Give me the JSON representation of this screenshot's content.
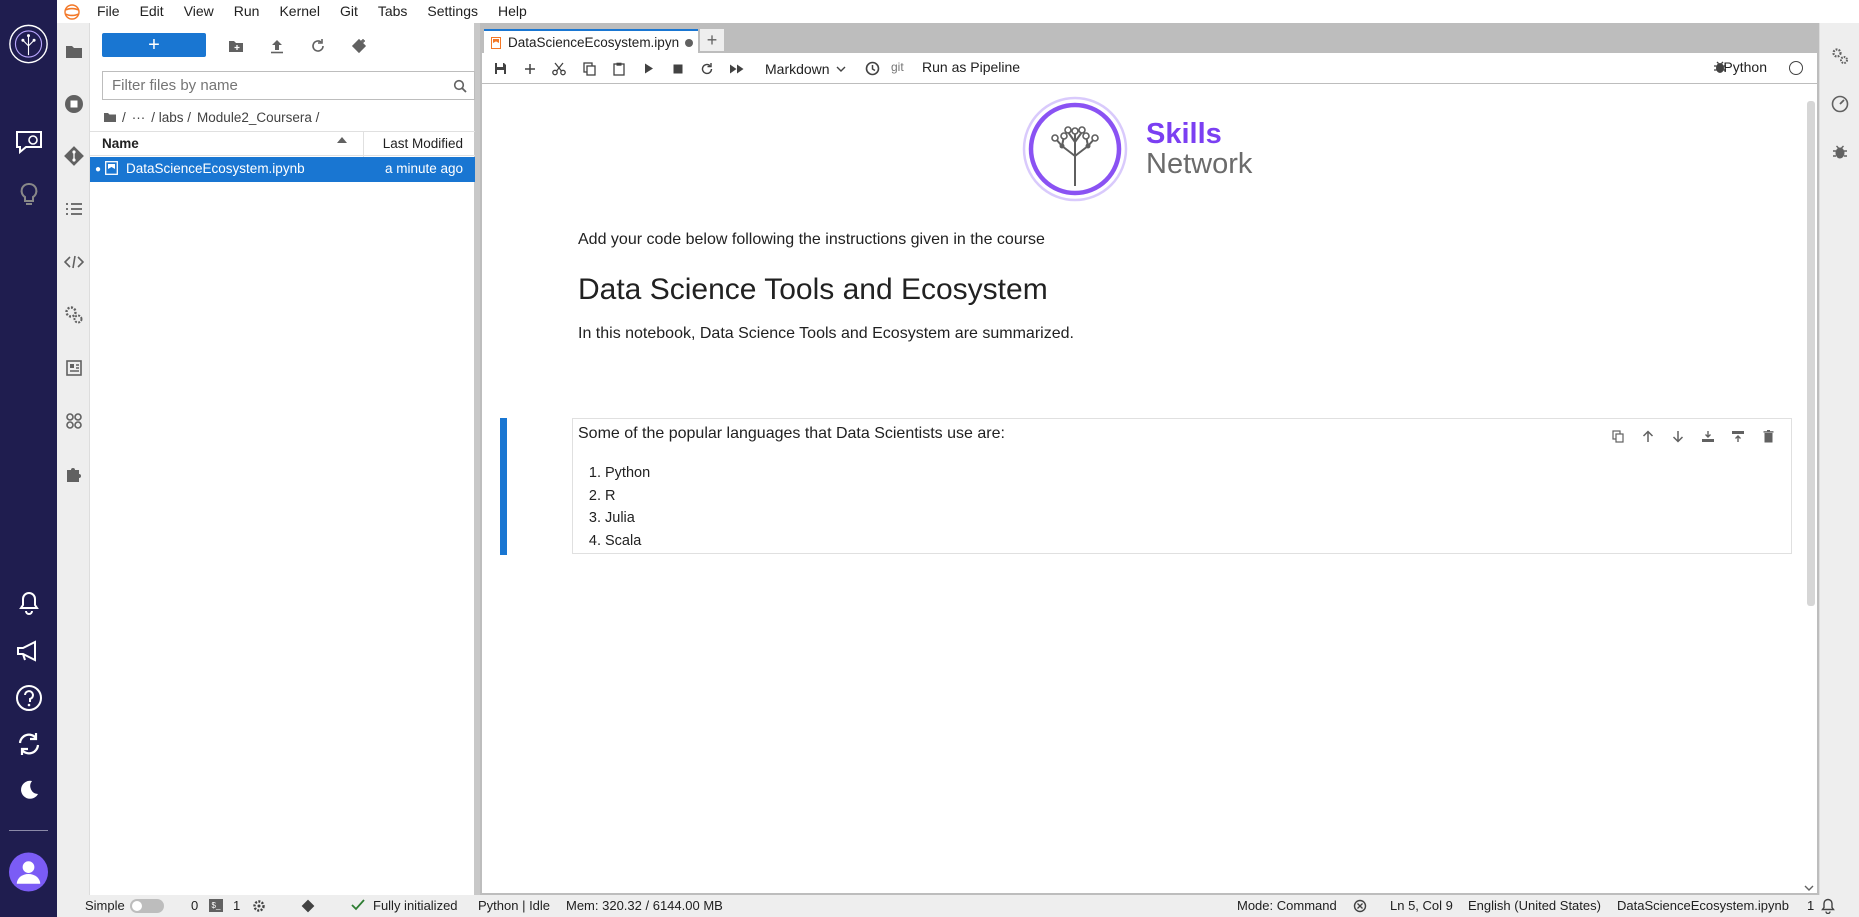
{
  "menu": {
    "items": [
      "File",
      "Edit",
      "View",
      "Run",
      "Kernel",
      "Git",
      "Tabs",
      "Settings",
      "Help"
    ]
  },
  "filebrowser": {
    "new_label": "+",
    "search_placeholder": "Filter files by name",
    "breadcrumb": [
      "/",
      "···",
      "/ labs /",
      "Module2_Coursera /"
    ],
    "columns": {
      "name": "Name",
      "modified": "Last Modified"
    },
    "files": [
      {
        "name": "DataScienceEcosystem.ipynb",
        "modified": "a minute ago",
        "selected": true
      }
    ]
  },
  "tabs": {
    "active": "DataScienceEcosystem.ipyn",
    "add": "+"
  },
  "notebook_toolbar": {
    "cell_type": "Markdown",
    "git": "git",
    "pipeline": "Run as Pipeline",
    "kernel": "Python"
  },
  "notebook": {
    "logo_line1": "Skills",
    "logo_line2": "Network",
    "intro": "Add your code below following the instructions given in the course",
    "heading": "Data Science Tools and Ecosystem",
    "summary": "In this notebook, Data Science Tools and Ecosystem are summarized.",
    "active_cell": {
      "text": "Some of the popular languages that Data Scientists use are:",
      "languages": [
        "Python",
        "R",
        "Julia",
        "Scala"
      ]
    }
  },
  "statusbar": {
    "mode_label": "Simple",
    "count_a": "0",
    "count_b": "1",
    "init": "Fully initialized",
    "kernel": "Python | Idle",
    "mem": "Mem: 320.32 / 6144.00 MB",
    "mode": "Mode: Command",
    "position": "Ln 5, Col 9",
    "language": "English (United States)",
    "file": "DataScienceEcosystem.ipynb",
    "notifications": "1"
  },
  "colors": {
    "rail": "#1f1d4f",
    "accent": "#1976d2",
    "logo_purple": "#7b3ff2"
  }
}
